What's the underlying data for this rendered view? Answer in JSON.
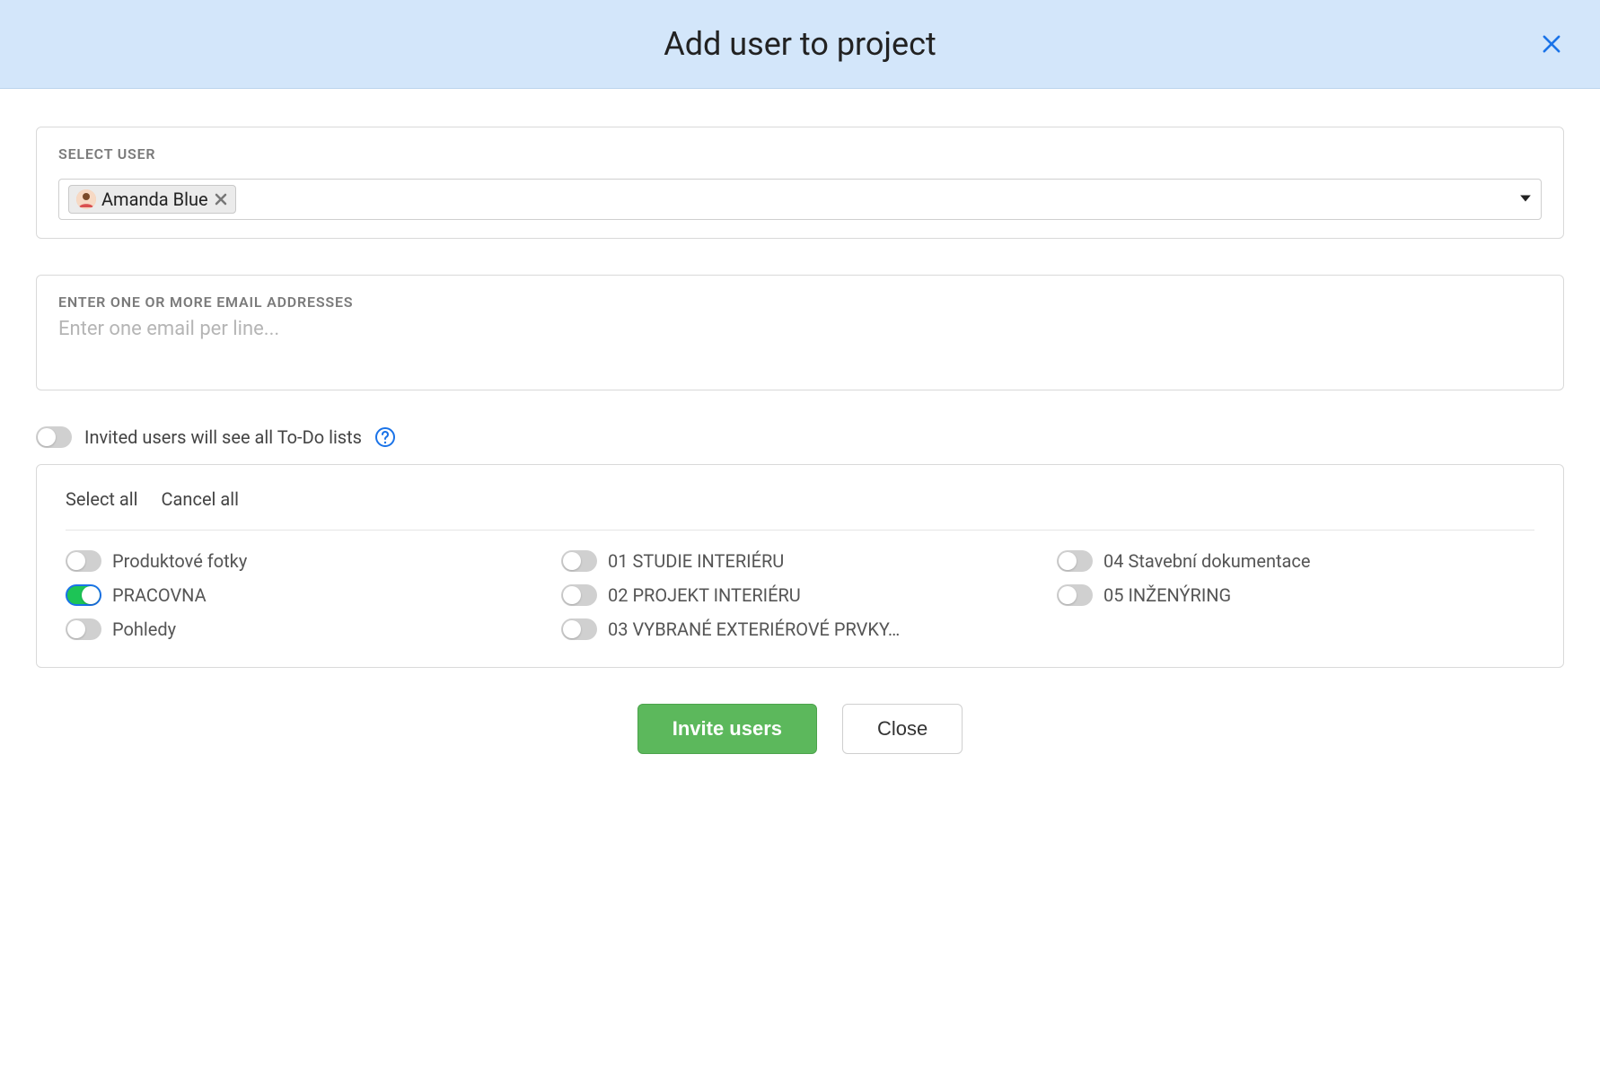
{
  "header": {
    "title": "Add user to project"
  },
  "select_user": {
    "label": "SELECT USER",
    "chip_name": "Amanda Blue"
  },
  "email": {
    "label": "ENTER ONE OR MORE EMAIL ADDRESSES",
    "placeholder": "Enter one email per line..."
  },
  "visibility_toggle": {
    "label": "Invited users will see all To-Do lists",
    "on": false
  },
  "lists": {
    "select_all": "Select all",
    "cancel_all": "Cancel all",
    "items": [
      {
        "label": "Produktové fotky",
        "on": false
      },
      {
        "label": "01 STUDIE INTERIÉRU",
        "on": false
      },
      {
        "label": "04 Stavební dokumentace",
        "on": false
      },
      {
        "label": "PRACOVNA",
        "on": true
      },
      {
        "label": "02 PROJEKT INTERIÉRU",
        "on": false
      },
      {
        "label": "05 INŽENÝRING",
        "on": false
      },
      {
        "label": "Pohledy",
        "on": false
      },
      {
        "label": "03 VYBRANÉ EXTERIÉROVÉ PRVKY…",
        "on": false
      }
    ]
  },
  "footer": {
    "invite": "Invite users",
    "close": "Close"
  }
}
